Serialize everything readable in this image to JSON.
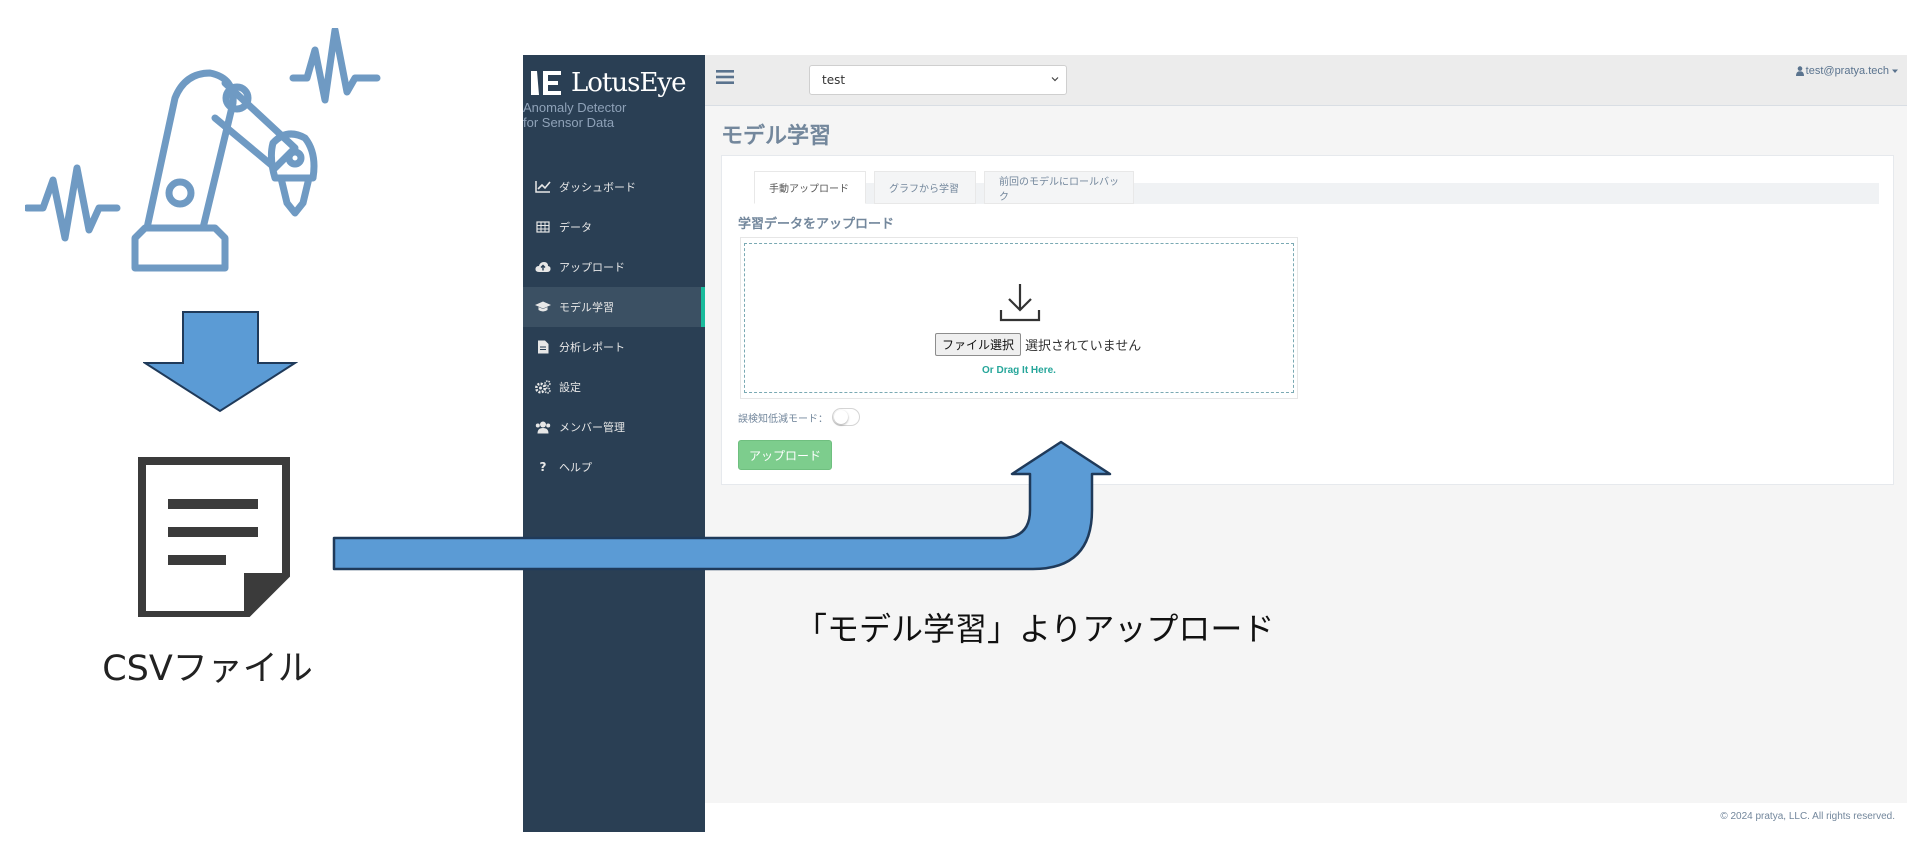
{
  "illustration": {
    "file_label": "CSVファイル",
    "colors": {
      "robot": "#6f9ac3",
      "arrow": "#5b9bd5",
      "arrow_outline": "#1f3a5a",
      "doc": "#3b3b3b"
    },
    "icons": [
      "robot-arm-icon",
      "sensor-wave-icon",
      "down-arrow-icon",
      "document-icon",
      "flow-arrow-icon"
    ]
  },
  "app": {
    "brand": {
      "name": "LotusEye",
      "subtitle_line1": "Anomaly Detector",
      "subtitle_line2": "for Sensor Data"
    },
    "nav": [
      {
        "label": "ダッシュボード",
        "icon": "line-chart-icon",
        "active": false
      },
      {
        "label": "データ",
        "icon": "table-icon",
        "active": false
      },
      {
        "label": "アップロード",
        "icon": "cloud-upload-icon",
        "active": false
      },
      {
        "label": "モデル学習",
        "icon": "graduation-cap-icon",
        "active": true
      },
      {
        "label": "分析レポート",
        "icon": "file-icon",
        "active": false
      },
      {
        "label": "設定",
        "icon": "gears-icon",
        "active": false
      },
      {
        "label": "メンバー管理",
        "icon": "users-icon",
        "active": false
      },
      {
        "label": "ヘルプ",
        "icon": "question-icon",
        "active": false
      }
    ],
    "topbar": {
      "project_selected": "test",
      "user": "test@pratya.tech"
    },
    "page_title": "モデル学習",
    "tabs": [
      {
        "label": "手動アップロード",
        "active": true
      },
      {
        "label": "グラフから学習",
        "active": false
      },
      {
        "label": "前回のモデルにロールバック",
        "active": false
      }
    ],
    "upload": {
      "heading": "学習データをアップロード",
      "file_button": "ファイル選択",
      "file_status": "選択されていません",
      "drag_hint": "Or Drag It Here.",
      "mode_label": "誤検知低減モード：",
      "mode_on": false,
      "submit": "アップロード"
    },
    "footer": "© 2024 pratya, LLC. All rights reserved.",
    "colors": {
      "sidebar": "#2a3f54",
      "active_accent": "#1abb9c",
      "title": "#73879c",
      "upload_button": "#7dcd8d",
      "drag_hint": "#26a69a"
    }
  },
  "caption": "「モデル学習」よりアップロード"
}
